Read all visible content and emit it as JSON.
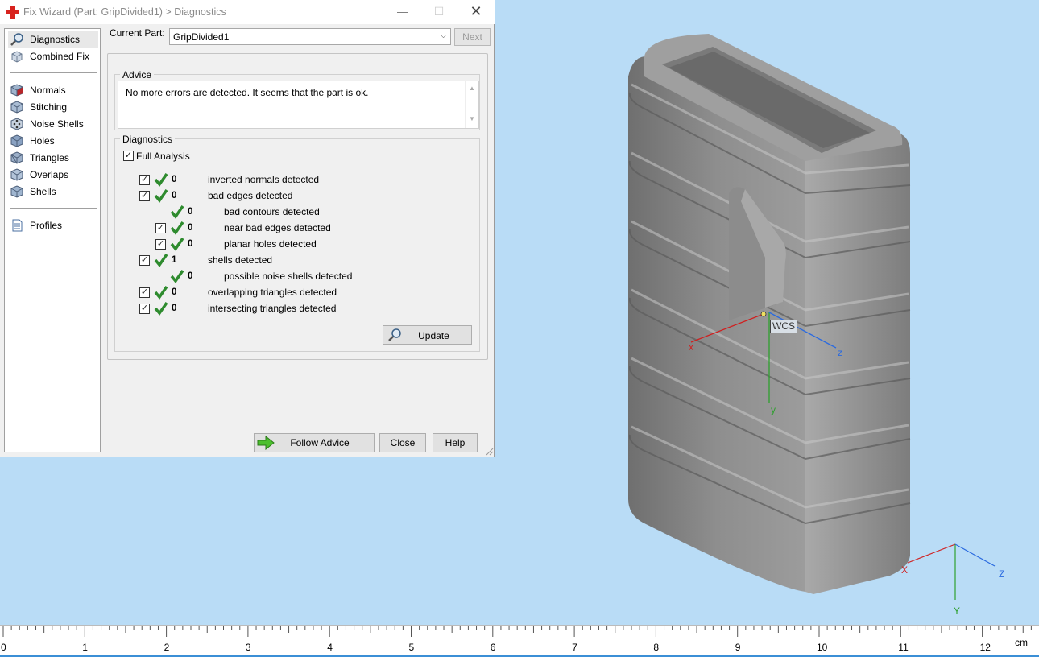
{
  "window": {
    "title": "Fix Wizard (Part: GripDivided1) > Diagnostics"
  },
  "sidebar": {
    "items": [
      {
        "label": "Diagnostics",
        "icon": "magnifier-icon",
        "selected": true
      },
      {
        "label": "Combined Fix",
        "icon": "cube-wand-icon"
      },
      {
        "label": "Normals",
        "icon": "normals-cube-icon"
      },
      {
        "label": "Stitching",
        "icon": "stitching-cube-icon"
      },
      {
        "label": "Noise Shells",
        "icon": "noise-dice-icon"
      },
      {
        "label": "Holes",
        "icon": "holes-cube-icon"
      },
      {
        "label": "Triangles",
        "icon": "triangles-cube-icon"
      },
      {
        "label": "Overlaps",
        "icon": "overlaps-cube-icon"
      },
      {
        "label": "Shells",
        "icon": "shells-cube-icon"
      },
      {
        "label": "Profiles",
        "icon": "document-icon"
      }
    ]
  },
  "current_part": {
    "label": "Current Part:",
    "value": "GripDivided1",
    "next_label": "Next"
  },
  "advice": {
    "legend": "Advice",
    "text": "No more errors are detected. It seems that the part is ok."
  },
  "diagnostics": {
    "legend": "Diagnostics",
    "full_analysis_label": "Full Analysis",
    "full_analysis_checked": true,
    "rows": [
      {
        "count": "0",
        "label": "inverted normals detected",
        "checked": true,
        "ok": true
      },
      {
        "count": "0",
        "label": "bad edges detected",
        "checked": true,
        "ok": true
      },
      {
        "count": "0",
        "label": "bad contours detected",
        "ok": true
      },
      {
        "count": "0",
        "label": "near bad edges detected",
        "checked": true,
        "ok": true
      },
      {
        "count": "0",
        "label": "planar holes detected",
        "checked": true,
        "ok": true
      },
      {
        "count": "1",
        "label": "shells detected",
        "checked": true,
        "ok": true
      },
      {
        "count": "0",
        "label": "possible noise shells detected",
        "ok": true
      },
      {
        "count": "0",
        "label": "overlapping triangles detected",
        "checked": true,
        "ok": true
      },
      {
        "count": "0",
        "label": "intersecting triangles detected",
        "checked": true,
        "ok": true
      }
    ],
    "update_label": "Update"
  },
  "buttons": {
    "follow_advice": "Follow Advice",
    "close": "Close",
    "help": "Help"
  },
  "viewport": {
    "wcs_label": "WCS",
    "axis_labels": {
      "x": "x",
      "y": "y",
      "z": "z"
    },
    "corner_axis_labels": {
      "x": "X",
      "y": "Y",
      "z": "Z"
    },
    "ruler": {
      "numbers": [
        "0",
        "1",
        "2",
        "3",
        "4",
        "5",
        "6",
        "7",
        "8",
        "9",
        "10",
        "11",
        "12"
      ],
      "unit": "cm"
    }
  },
  "colors": {
    "background": "#b9dcf6",
    "check_green": "#2e8b2e",
    "axis_x": "#d02020",
    "axis_y": "#2ea02e",
    "axis_z": "#2a6ae0"
  }
}
